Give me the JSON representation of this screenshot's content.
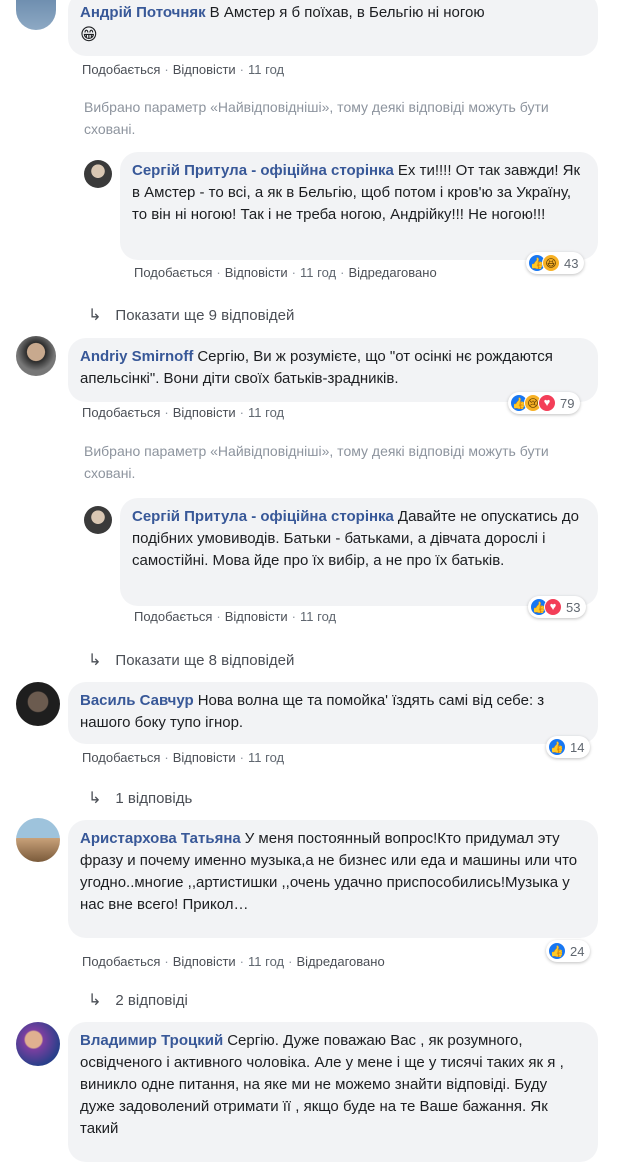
{
  "colors": {
    "author": "#385898",
    "bubble": "#f2f3f5",
    "like": "#1877f2",
    "love": "#f33e58",
    "haha": "#f7b125"
  },
  "actions": {
    "like": "Подобається",
    "reply": "Відповісти",
    "edited": "Відредаговано"
  },
  "filter_note": "Вибрано параметр «Найвідповідніші», тому деякі відповіді можуть бути сховані.",
  "c1": {
    "author": "Андрій Поточняк",
    "text": "В Амстер я б поїхав, в Бельгію ні ногою",
    "emoji": "😁",
    "time": "11 год"
  },
  "c1r": {
    "author": "Сергій Притула - офіційна сторінка",
    "text": "Ех ти!!!! От так завжди! Як в Амстер - то всі, а як в Бельгію, щоб потом і кров'ю за Україну, то він ні ногою! Так і не треба ногою, Андрійку!!! Не ногою!!!",
    "time": "11 год",
    "reactions": {
      "icons": [
        "like-icon",
        "haha-icon"
      ],
      "count": "43"
    }
  },
  "more1": "Показати ще 9 відповідей",
  "c2": {
    "author": "Andriy Smirnoff",
    "text": "Сергію, Ви ж розумієте, що \"от осінкі нє рождаются апельсінкі\". Вони діти своїх батьків-зрадників.",
    "time": "11 год",
    "reactions": {
      "icons": [
        "like-icon",
        "sad-icon",
        "love-icon"
      ],
      "count": "79"
    }
  },
  "c2r": {
    "author": "Сергій Притула - офіційна сторінка",
    "text": "Давайте не опускатись до подібних умовиводів. Батьки - батьками, а дівчата дорослі і самостійні. Мова йде про їх вибір, а не про їх батьків.",
    "time": "11 год",
    "reactions": {
      "icons": [
        "like-icon",
        "love-icon"
      ],
      "count": "53"
    }
  },
  "more2": "Показати ще 8 відповідей",
  "c3": {
    "author": "Василь Савчур",
    "text": "Нова волна ще та помойка' їздять самі від себе: з нашого боку тупо ігнор.",
    "time": "11 год",
    "reactions": {
      "icons": [
        "like-icon"
      ],
      "count": "14"
    }
  },
  "more3": "1 відповідь",
  "c4": {
    "author": "Аристархова Татьяна",
    "text": "У меня постоянный вопрос!Кто придумал эту фразу и почему именно музыка,а не бизнес или еда и машины или что угодно..многие ,,артистишки ,,очень удачно приспособились!Музыка у нас вне всего! Прикол…",
    "time": "11 год",
    "reactions": {
      "icons": [
        "like-icon"
      ],
      "count": "24"
    }
  },
  "more4": "2 відповіді",
  "c5": {
    "author": "Владимир Троцкий",
    "text": "Сергію. Дуже поважаю Вас , як розумного, освідченого і активного чоловіка. Але у мене і ще у тисячі таких як я , виникло одне питання, на яке ми не можемо знайти відповіді. Буду дуже задоволений отримати її , якщо буде на те Ваше бажання. Як такий"
  }
}
